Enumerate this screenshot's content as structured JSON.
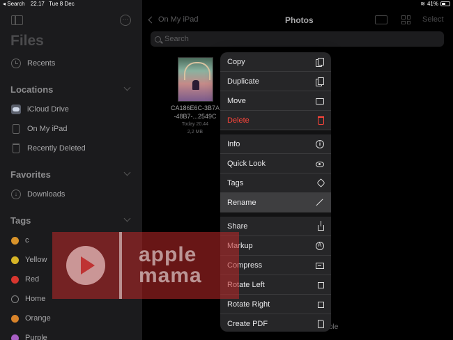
{
  "status_bar": {
    "back_app": "◂ Search",
    "time": "22.17",
    "date": "Tue 8 Dec",
    "battery": "41%",
    "battery_level": 0.41
  },
  "sidebar": {
    "title": "Files",
    "recents": "Recents",
    "locations_header": "Locations",
    "locations": [
      {
        "label": "iCloud Drive",
        "icon": "icloud-icon"
      },
      {
        "label": "On My iPad",
        "icon": "ipad-icon"
      },
      {
        "label": "Recently Deleted",
        "icon": "trash-icon"
      }
    ],
    "favorites_header": "Favorites",
    "favorites": [
      {
        "label": "Downloads",
        "icon": "download-icon"
      }
    ],
    "tags_header": "Tags",
    "tags": [
      {
        "label": "c",
        "color": "#d8932a"
      },
      {
        "label": "Yellow",
        "color": "#d6b426"
      },
      {
        "label": "Red",
        "color": "#d8362f"
      },
      {
        "label": "Home",
        "color": "transparent"
      },
      {
        "label": "Orange",
        "color": "#d8832a"
      },
      {
        "label": "Purple",
        "color": "#a85fc4"
      }
    ]
  },
  "main": {
    "back_label": "On My iPad",
    "title": "Photos",
    "select_label": "Select",
    "search_placeholder": "Search",
    "file": {
      "name_line1": "CA186E6C-3B7A",
      "name_line2": "-48B7-...2549C",
      "date": "Today 20.44",
      "size": "2,2 MB"
    },
    "partial_text": "ble"
  },
  "context_menu": {
    "groups": [
      [
        {
          "label": "Copy",
          "icon": "copy-icon"
        },
        {
          "label": "Duplicate",
          "icon": "duplicate-icon"
        },
        {
          "label": "Move",
          "icon": "folder-icon"
        },
        {
          "label": "Delete",
          "icon": "trash-icon",
          "destructive": true
        }
      ],
      [
        {
          "label": "Info",
          "icon": "info-icon"
        },
        {
          "label": "Quick Look",
          "icon": "eye-icon"
        },
        {
          "label": "Tags",
          "icon": "tag-icon"
        },
        {
          "label": "Rename",
          "icon": "pencil-icon",
          "highlighted": true
        }
      ],
      [
        {
          "label": "Share",
          "icon": "share-icon"
        },
        {
          "label": "Markup",
          "icon": "markup-icon"
        },
        {
          "label": "Compress",
          "icon": "archive-icon"
        },
        {
          "label": "Rotate Left",
          "icon": "rotate-left-icon"
        },
        {
          "label": "Rotate Right",
          "icon": "rotate-right-icon"
        },
        {
          "label": "Create PDF",
          "icon": "pdf-icon"
        }
      ]
    ]
  },
  "watermark": {
    "line1": "apple",
    "line2": "mama"
  },
  "colors": {
    "destructive": "#ff453a",
    "sidebar_bg": "#1b1b1d",
    "menu_bg": "#262628"
  }
}
